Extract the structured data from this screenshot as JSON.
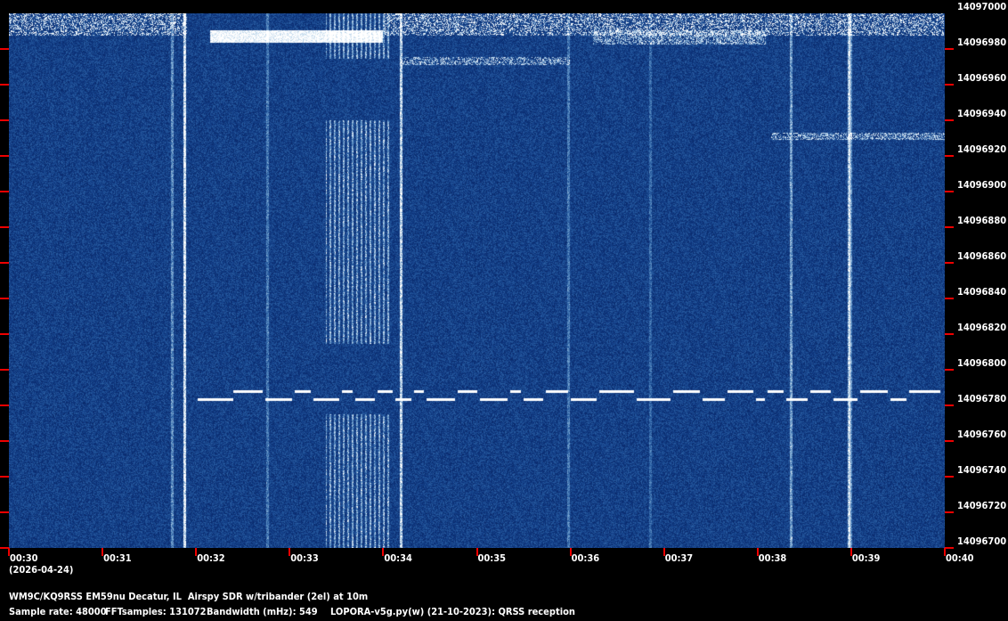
{
  "chart_data": {
    "type": "heatmap",
    "title": "WM9C/KQ9RSS EM59nu Decatur, IL  Airspy SDR w/tribander (2el) at 10m",
    "date": "(2026-04-24)",
    "x_ticks": [
      "00:30",
      "00:31",
      "00:32",
      "00:33",
      "00:34",
      "00:35",
      "00:36",
      "00:37",
      "00:38",
      "00:39",
      "00:40"
    ],
    "y_ticks": [
      "14097000",
      "14096980",
      "14096960",
      "14096940",
      "14096920",
      "14096900",
      "14096880",
      "14096860",
      "14096840",
      "14096820",
      "14096800",
      "14096780",
      "14096760",
      "14096740",
      "14096720",
      "14096700"
    ],
    "xlim_minutes": [
      30,
      40
    ],
    "ylim_hz": [
      14096700,
      14097000
    ],
    "colors": {
      "background": "#0b2a66",
      "signal": "#ffffff",
      "tick": "#e00000"
    }
  },
  "footer": {
    "sample_rate": "Sample rate: 48000",
    "fft_samples": "FFTsamples: 131072",
    "bandwidth": "Bandwidth (mHz): 549",
    "software": "LOPORA-v5g.py(w) (21-10-2023): QRSS reception"
  }
}
